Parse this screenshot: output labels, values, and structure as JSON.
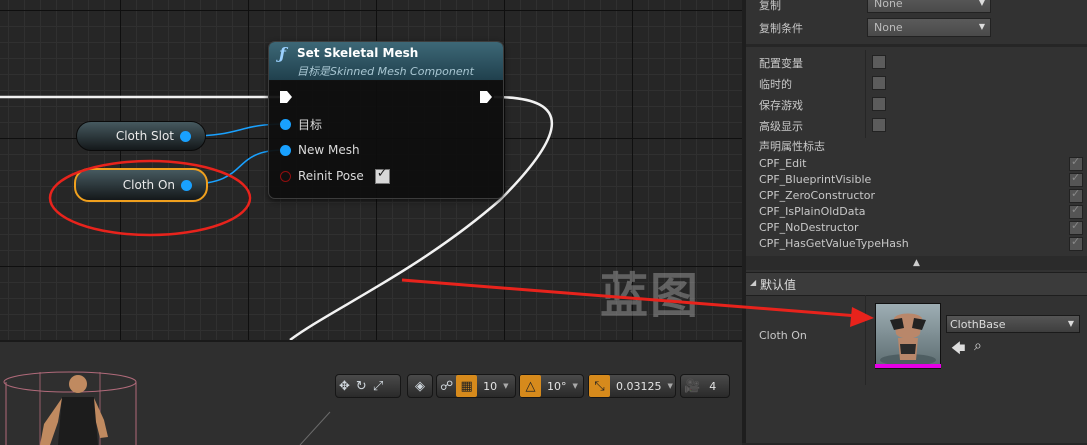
{
  "node": {
    "function_icon": "ƒ",
    "title": "Set Skeletal Mesh",
    "subtitle": "目标是Skinned Mesh Component",
    "pins": [
      "目标",
      "New Mesh",
      "Reinit Pose"
    ],
    "reinit_pose_checked": true,
    "check_mark": "✓"
  },
  "variables": {
    "cloth_slot": "Cloth Slot",
    "cloth_on": "Cloth On"
  },
  "toolbar": {
    "grid_snap": "10",
    "rotation_snap": "10°",
    "scale_snap": "0.03125",
    "camera_speed": "4",
    "icons": [
      "translate-icon",
      "rotate-icon",
      "scale-icon",
      "world-icon",
      "surface-snap-icon",
      "grid-icon",
      "angle-icon",
      "scale-snap-icon",
      "camera-speed-icon"
    ]
  },
  "details": {
    "replication": {
      "label": "复制",
      "value": "None"
    },
    "replication_condition": {
      "label": "复制条件",
      "value": "None"
    },
    "flags": [
      {
        "label": "配置变量",
        "checked": false
      },
      {
        "label": "临时的",
        "checked": false
      },
      {
        "label": "保存游戏",
        "checked": false
      },
      {
        "label": "高级显示",
        "checked": false
      }
    ],
    "property_flags_label": "声明属性标志",
    "property_flags": [
      "CPF_Edit",
      "CPF_BlueprintVisible",
      "CPF_ZeroConstructor",
      "CPF_IsPlainOldData",
      "CPF_NoDestructor",
      "CPF_HasGetValueTypeHash"
    ],
    "default_value_header": "默认值",
    "default_row": {
      "label": "Cloth On",
      "asset": "ClothBase"
    }
  },
  "watermark": "蓝图",
  "colors": {
    "annotation_red": "#e8231c",
    "pin_blue": "#19a1ff",
    "selection_orange": "#f0a01e",
    "thumbnail_magenta": "#e600e6"
  }
}
